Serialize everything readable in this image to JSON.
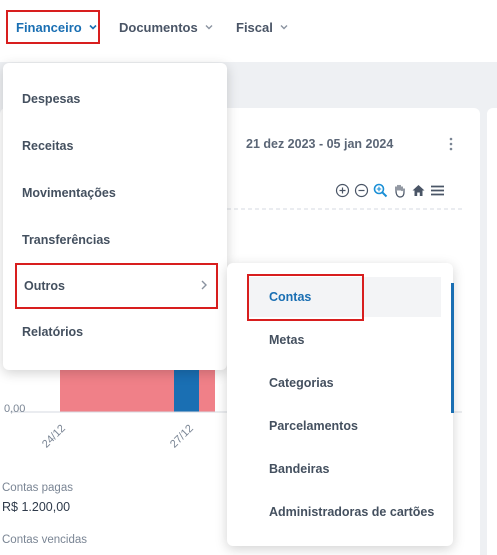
{
  "nav": {
    "items": [
      {
        "label": "Financeiro"
      },
      {
        "label": "Documentos"
      },
      {
        "label": "Fiscal"
      }
    ]
  },
  "card": {
    "date_range": "21 dez 2023 - 05 jan 2024",
    "toolbar_icons": [
      "zoom-in-icon",
      "zoom-out-icon",
      "magnifier-icon",
      "pan-hand-icon",
      "home-icon",
      "menu-icon"
    ]
  },
  "chart_data": {
    "type": "bar",
    "y_tick_labels": [
      "0,00"
    ],
    "x_tick_labels": [
      "24/12",
      "27/12"
    ],
    "colors": {
      "pink": "#f08088",
      "blue": "#1a6fb3"
    }
  },
  "legend": {
    "paid_label": "Contas pagas",
    "paid_value": "R$ 1.200,00",
    "overdue_label": "Contas vencidas"
  },
  "menu": {
    "items": [
      {
        "label": "Despesas"
      },
      {
        "label": "Receitas"
      },
      {
        "label": "Movimentações"
      },
      {
        "label": "Transferências"
      },
      {
        "label": "Outros"
      },
      {
        "label": "Relatórios"
      }
    ]
  },
  "submenu": {
    "items": [
      {
        "label": "Contas"
      },
      {
        "label": "Metas"
      },
      {
        "label": "Categorias"
      },
      {
        "label": "Parcelamentos"
      },
      {
        "label": "Bandeiras"
      },
      {
        "label": "Administradoras de cartões"
      }
    ]
  },
  "colors": {
    "accent": "#1a6fb3",
    "highlight_border": "#d81e1e",
    "menu_text": "#44505f"
  }
}
